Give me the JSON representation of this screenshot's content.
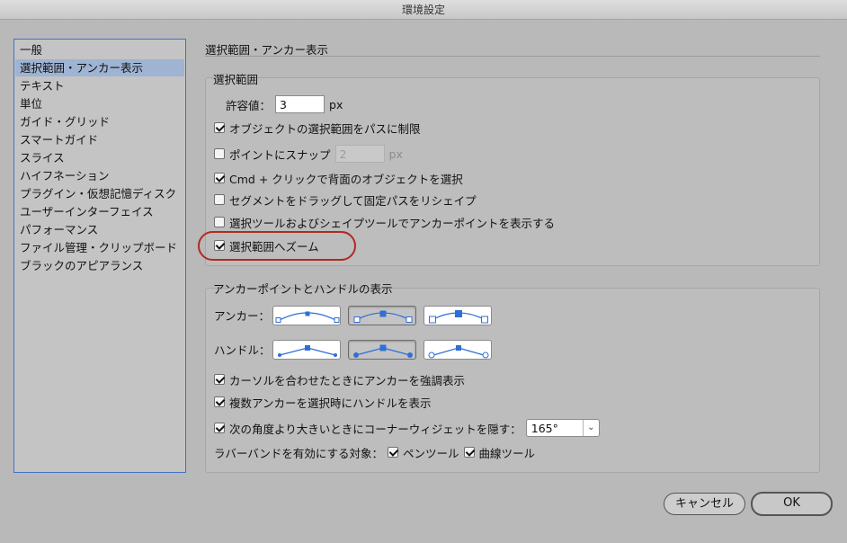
{
  "window": {
    "title": "環境設定"
  },
  "sidebar": {
    "items": [
      {
        "label": "一般"
      },
      {
        "label": "選択範囲・アンカー表示",
        "selected": true
      },
      {
        "label": "テキスト"
      },
      {
        "label": "単位"
      },
      {
        "label": "ガイド・グリッド"
      },
      {
        "label": "スマートガイド"
      },
      {
        "label": "スライス"
      },
      {
        "label": "ハイフネーション"
      },
      {
        "label": "プラグイン・仮想記憶ディスク"
      },
      {
        "label": "ユーザーインターフェイス"
      },
      {
        "label": "パフォーマンス"
      },
      {
        "label": "ファイル管理・クリップボード"
      },
      {
        "label": "ブラックのアピアランス"
      }
    ]
  },
  "main": {
    "section_title": "選択範囲・アンカー表示",
    "selection": {
      "group_label": "選択範囲",
      "tolerance_label": "許容値：",
      "tolerance_value": "3",
      "tolerance_unit": "px",
      "object_selection_by_path": {
        "label": "オブジェクトの選択範囲をパスに制限",
        "checked": true
      },
      "snap_to_point": {
        "label": "ポイントにスナップ",
        "checked": false,
        "value": "2",
        "unit": "px"
      },
      "cmd_click": {
        "label": "Cmd + クリックで背面のオブジェクトを選択",
        "checked": true
      },
      "drag_segment": {
        "label": "セグメントをドラッグして固定パスをリシェイプ",
        "checked": false
      },
      "show_anchor_points": {
        "label": "選択ツールおよびシェイプツールでアンカーポイントを表示する",
        "checked": false
      },
      "zoom_to_selection": {
        "label": "選択範囲へズーム",
        "checked": true
      }
    },
    "anchor_display": {
      "group_label": "アンカーポイントとハンドルの表示",
      "anchor_label": "アンカー：",
      "anchor_selected_index": 1,
      "handle_label": "ハンドル：",
      "handle_selected_index": 1,
      "highlight_anchors": {
        "label": "カーソルを合わせたときにアンカーを強調表示",
        "checked": true
      },
      "show_handles_multi": {
        "label": "複数アンカーを選択時にハンドルを表示",
        "checked": true
      },
      "hide_corner_widget": {
        "label": "次の角度より大きいときにコーナーウィジェットを隠す：",
        "checked": true,
        "value": "165°"
      },
      "rubber_band_label": "ラバーバンドを有効にする対象：",
      "pen_tool": {
        "label": "ペンツール",
        "checked": true
      },
      "curvature_tool": {
        "label": "曲線ツール",
        "checked": true
      }
    }
  },
  "buttons": {
    "cancel": "キャンセル",
    "ok": "OK"
  },
  "colors": {
    "accent_blue": "#2f6fd6",
    "highlight_red": "#b02a22",
    "sidebar_selection": "#9fb3d3"
  }
}
